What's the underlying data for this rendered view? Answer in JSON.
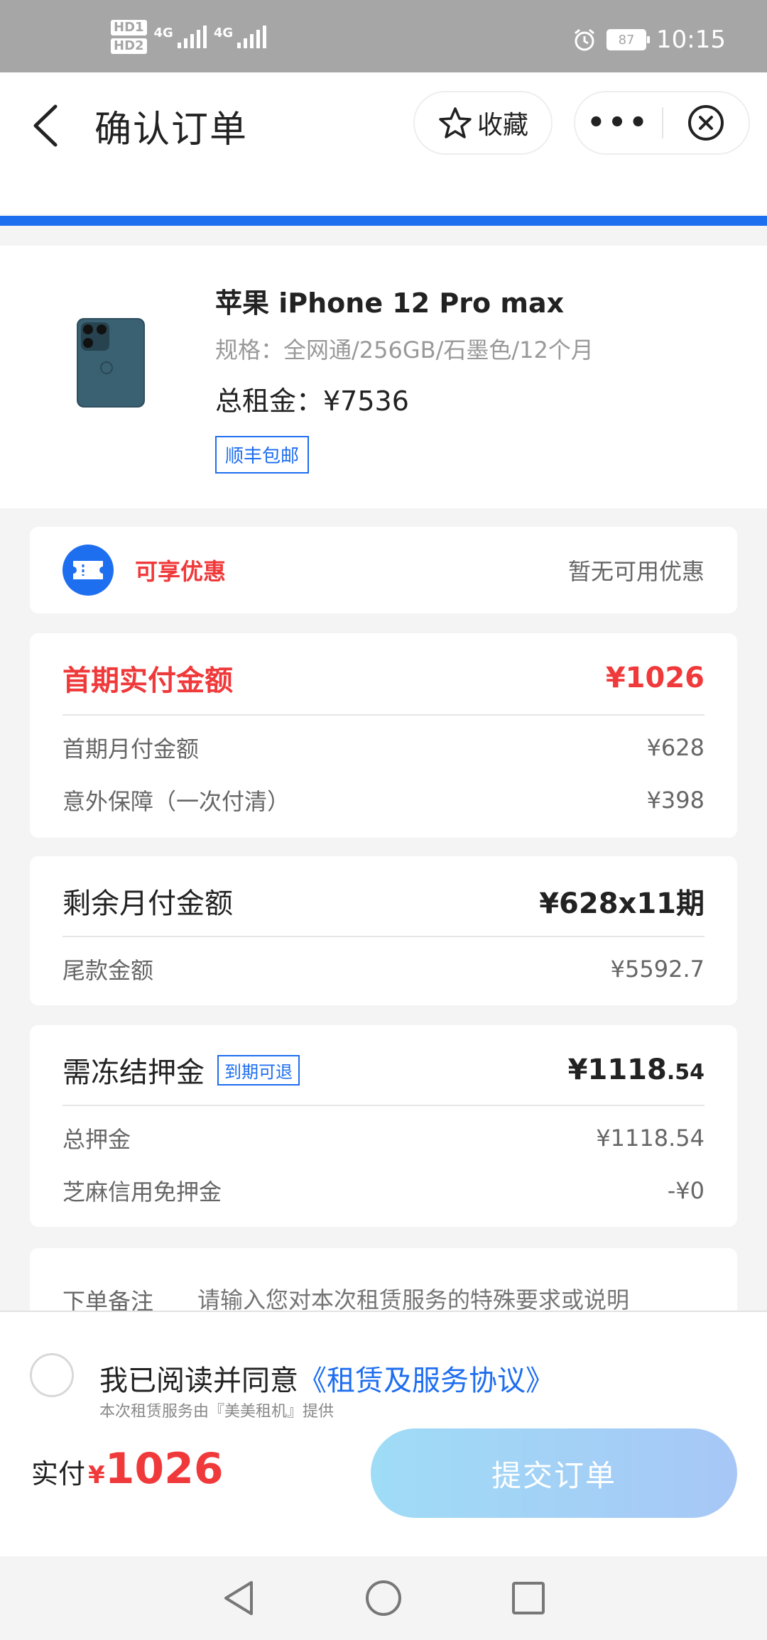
{
  "status_bar": {
    "hd1": "HD1",
    "hd2": "HD2",
    "net1": "4G",
    "net2": "4G",
    "battery": "87",
    "time": "10:15"
  },
  "header": {
    "title": "确认订单",
    "favorite_label": "收藏",
    "more_label": "•••"
  },
  "product": {
    "name": "苹果 iPhone 12 Pro max",
    "spec": "规格：全网通/256GB/石墨色/12个月",
    "total_rent": "总租金：¥7536",
    "shipping_tag": "顺丰包邮"
  },
  "coupon": {
    "label": "可享优惠",
    "status": "暂无可用优惠"
  },
  "first_payment": {
    "title": "首期实付金额",
    "amount": "¥1026",
    "rows": [
      {
        "label": "首期月付金额",
        "value": "¥628"
      },
      {
        "label": "意外保障（一次付清）",
        "value": "¥398"
      }
    ]
  },
  "remaining": {
    "title": "剩余月付金额",
    "amount": "¥628x11期",
    "rows": [
      {
        "label": "尾款金额",
        "value": "¥5592.7"
      }
    ]
  },
  "deposit": {
    "title": "需冻结押金",
    "badge": "到期可退",
    "amount_main": "¥1118",
    "amount_decimal": ".54",
    "rows": [
      {
        "label": "总押金",
        "value": "¥1118.54"
      },
      {
        "label": "芝麻信用免押金",
        "value": "-¥0"
      }
    ]
  },
  "remark": {
    "label": "下单备注",
    "placeholder": "请输入您对本次租赁服务的特殊要求或说明"
  },
  "footer": {
    "agree_text": "我已阅读并同意",
    "agreement_link": "《租赁及服务协议》",
    "provider": "本次租赁服务由『美美租机』提供",
    "paid_label": "实付",
    "paid_currency": "¥",
    "paid_amount": "1026",
    "submit_label": "提交订单"
  },
  "colors": {
    "accent_blue": "#1e6ef0",
    "price_red": "#f0393a",
    "status_bar": "#a6a6a6"
  }
}
